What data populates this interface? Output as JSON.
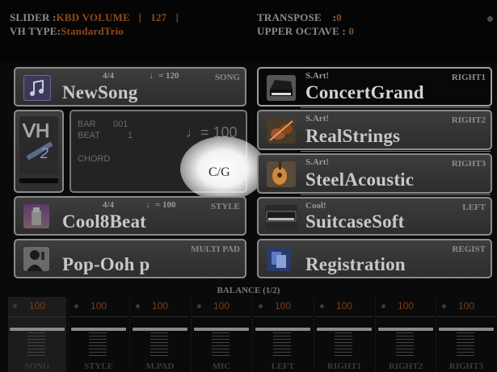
{
  "header": {
    "slider_label": "SLIDER",
    "slider_value": "KBD VOLUME",
    "slider_number": "127",
    "vh_type_label": "VH TYPE",
    "vh_type_value": "StandardTrio",
    "transpose_label": "TRANSPOSE",
    "transpose_value": "0",
    "upper_octave_label": "UPPER OCTAVE",
    "upper_octave_value": "0"
  },
  "song": {
    "time_sig": "4/4",
    "tempo": "♩= 120",
    "tag": "SONG",
    "name": "NewSong"
  },
  "info": {
    "bar_label": "BAR",
    "bar_value": "001",
    "beat_label": "BEAT",
    "beat_value": "1",
    "tempo": "♩= 100",
    "chord_label": "CHORD",
    "chord_value": "C/G"
  },
  "style": {
    "time_sig": "4/4",
    "tempo": "♩= 100",
    "tag": "STYLE",
    "name": "Cool8Beat"
  },
  "multipad": {
    "tag": "MULTI PAD",
    "name": "Pop-Ooh p"
  },
  "voices": [
    {
      "category": "S.Art!",
      "part": "RIGHT1",
      "name": "ConcertGrand"
    },
    {
      "category": "S.Art!",
      "part": "RIGHT2",
      "name": "RealStrings"
    },
    {
      "category": "S.Art!",
      "part": "RIGHT3",
      "name": "SteelAcoustic"
    },
    {
      "category": "Cool!",
      "part": "LEFT",
      "name": "SuitcaseSoft"
    }
  ],
  "regist": {
    "tag": "REGIST",
    "name": "Registration"
  },
  "balance": {
    "title": "BALANCE (1/2)",
    "channels": [
      {
        "label": "SONG",
        "value": "100"
      },
      {
        "label": "STYLE",
        "value": "100"
      },
      {
        "label": "M.PAD",
        "value": "100"
      },
      {
        "label": "MIC",
        "value": "100"
      },
      {
        "label": "LEFT",
        "value": "100"
      },
      {
        "label": "RIGHT1",
        "value": "100"
      },
      {
        "label": "RIGHT2",
        "value": "100"
      },
      {
        "label": "RIGHT3",
        "value": "100"
      }
    ]
  },
  "colors": {
    "value_accent": "#8b4b1d",
    "panel_border": "#8a8a8a",
    "background": "#0a0a0a"
  },
  "icons": {
    "song": "music-note-icon",
    "vh": "vocal-harmony-icon",
    "style": "style-icon",
    "multipad": "singer-icon",
    "regist": "registration-icon",
    "piano": "piano-icon",
    "strings": "violin-icon",
    "guitar": "guitar-icon",
    "epiano": "electric-piano-icon"
  }
}
